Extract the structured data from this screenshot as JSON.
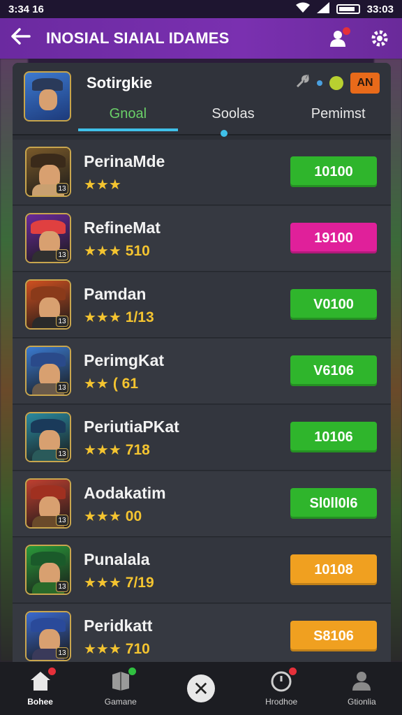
{
  "status_bar": {
    "time": "3:34 16",
    "right_time": "33:03"
  },
  "app_bar": {
    "title": "INOSIAL SIAIAL IDAMES"
  },
  "panel": {
    "title": "Sotirgkie",
    "an_button": "AN",
    "tabs": [
      "Gnoal",
      "Soolas",
      "Pemimst"
    ],
    "active_tab": 0
  },
  "rows": [
    {
      "name": "PerinaMde",
      "stars": "★★★",
      "score": "",
      "action": "10100",
      "action_color": "#2fb52c",
      "level": "13",
      "palette": [
        "#7a5a2a",
        "#c9a070",
        "#3a2a1a"
      ]
    },
    {
      "name": "RefineMat",
      "stars": "★★★",
      "score": "510",
      "action": "19100",
      "action_color": "#e0209a",
      "level": "13",
      "palette": [
        "#6a2a9a",
        "#303030",
        "#e04040"
      ]
    },
    {
      "name": "Pamdan",
      "stars": "★★★",
      "score": "1/13",
      "action": "V0100",
      "action_color": "#2fb52c",
      "level": "13",
      "palette": [
        "#d05020",
        "#2a2a2a",
        "#8a3a1a"
      ]
    },
    {
      "name": "PerimgKat",
      "stars": "★★",
      "score": "( 61",
      "action": "V6106",
      "action_color": "#2fb52c",
      "level": "13",
      "palette": [
        "#3a7ad0",
        "#6a5a4a",
        "#2a4a8a"
      ]
    },
    {
      "name": "PeriutiaPKat",
      "stars": "★★★",
      "score": "718",
      "action": "10106",
      "action_color": "#2fb52c",
      "level": "13",
      "palette": [
        "#2a8aa0",
        "#2a5a5a",
        "#1a3a5a"
      ]
    },
    {
      "name": "Aodakatim",
      "stars": "★★★",
      "score": "00",
      "action": "Sl0ll0l6",
      "action_color": "#2fb52c",
      "level": "13",
      "palette": [
        "#c04030",
        "#6a4a2a",
        "#a03020"
      ]
    },
    {
      "name": "Punalala",
      "stars": "★★★",
      "score": "7/19",
      "action": "10108",
      "action_color": "#f0a020",
      "level": "13",
      "palette": [
        "#2a9a3a",
        "#2a6a2a",
        "#1a5a2a"
      ]
    },
    {
      "name": "Peridkatt",
      "stars": "★★★",
      "score": "710",
      "action": "S8106",
      "action_color": "#f0a020",
      "level": "13",
      "palette": [
        "#3a6ad0",
        "#3a3a5a",
        "#2a4a9a"
      ]
    }
  ],
  "bottom_nav": [
    {
      "label": "Bohee",
      "icon": "home-icon",
      "dot": "#e5303a",
      "active": true
    },
    {
      "label": "Gamane",
      "icon": "box-icon",
      "dot": "#30c040",
      "active": false
    },
    {
      "label": "",
      "icon": "close-icon",
      "dot": "",
      "active": false
    },
    {
      "label": "Hrodhoe",
      "icon": "clock-icon",
      "dot": "#e5303a",
      "active": false
    },
    {
      "label": "Gtionlia",
      "icon": "user-icon",
      "dot": "",
      "active": false
    }
  ]
}
